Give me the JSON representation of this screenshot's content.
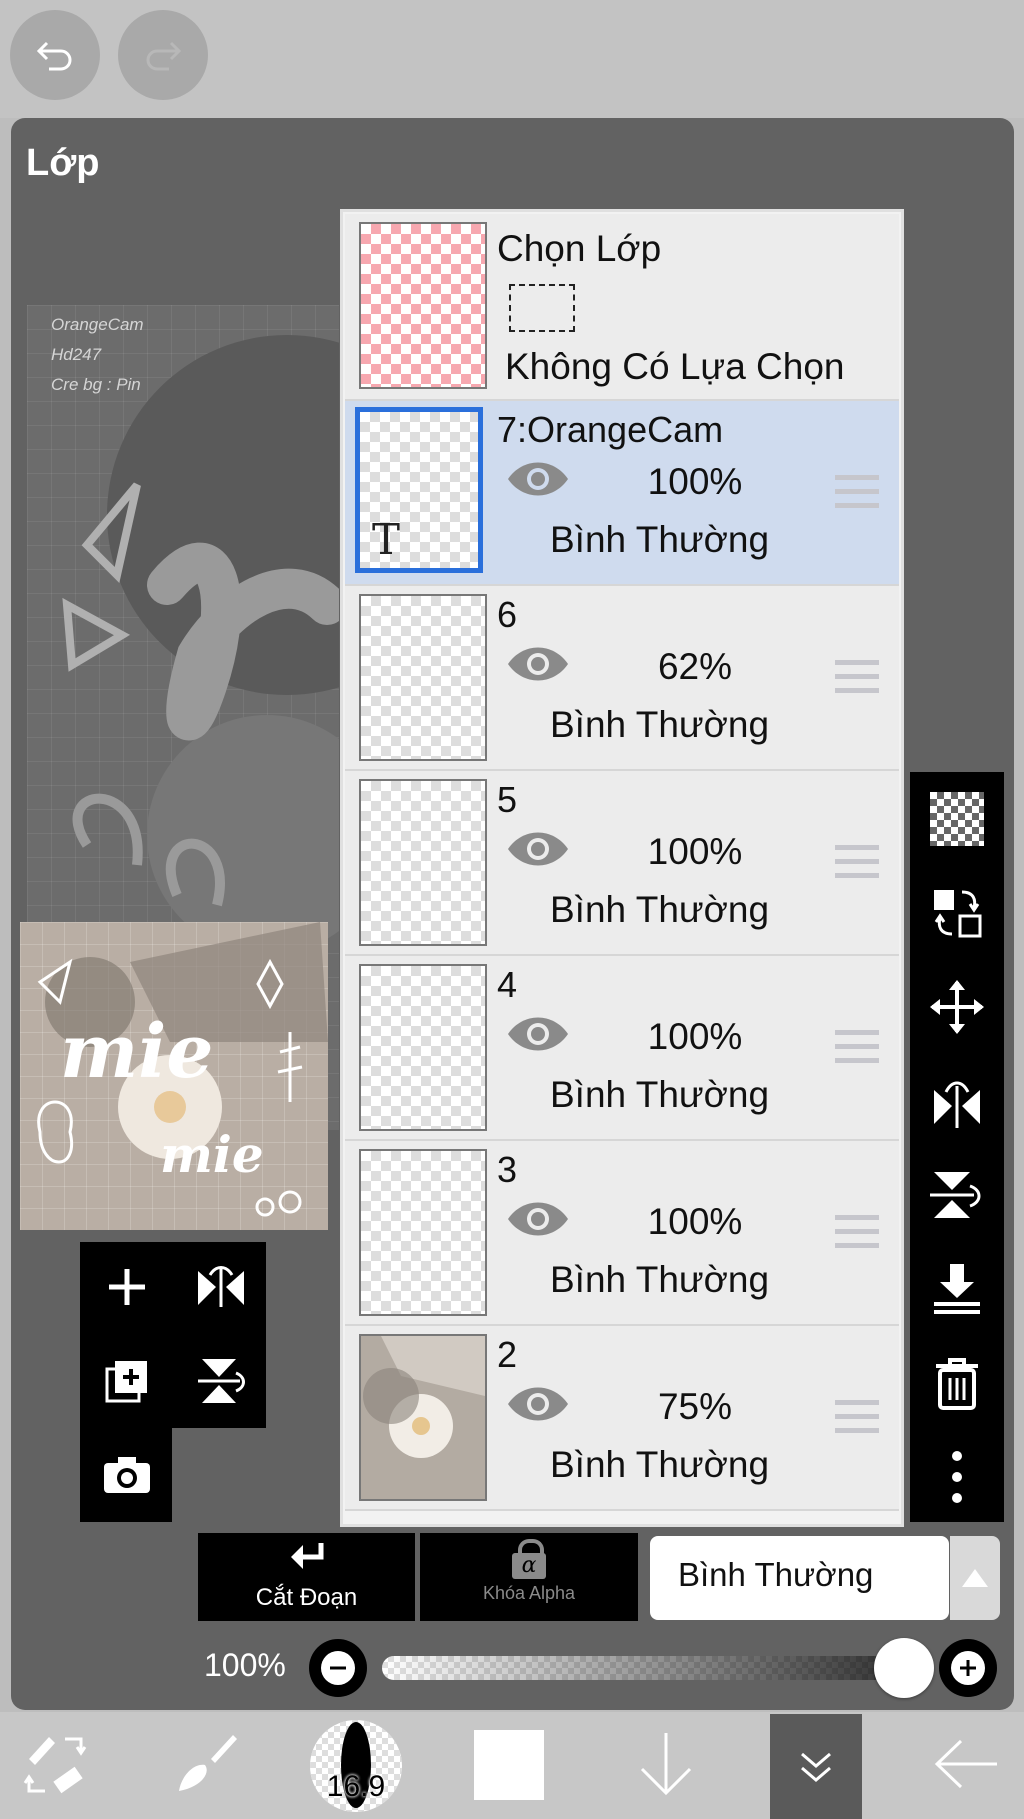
{
  "panel": {
    "title": "Lớp"
  },
  "canvas_watermark": {
    "line1": "OrangeCam",
    "line2": "Hd247",
    "line3": "Cre bg : Pin"
  },
  "selection": {
    "title": "Chọn Lớp",
    "status": "Không Có Lựa Chọn"
  },
  "layers": [
    {
      "name": "7:OrangeCam",
      "opacity": "100%",
      "blend": "Bình Thường",
      "selected": true,
      "type": "text",
      "thumb_text": "T"
    },
    {
      "name": "6",
      "opacity": "62%",
      "blend": "Bình Thường"
    },
    {
      "name": "5",
      "opacity": "100%",
      "blend": "Bình Thường"
    },
    {
      "name": "4",
      "opacity": "100%",
      "blend": "Bình Thường"
    },
    {
      "name": "3",
      "opacity": "100%",
      "blend": "Bình Thường"
    },
    {
      "name": "2",
      "opacity": "75%",
      "blend": "Bình Thường"
    }
  ],
  "controls": {
    "clip_label": "Cắt Đoạn",
    "alpha_lock_label": "Khóa Alpha",
    "alpha_symbol": "α",
    "blend_mode": "Bình Thường",
    "opacity_label": "100%",
    "opacity_value": 1.0
  },
  "bottom_bar": {
    "brush_size": "16.9"
  },
  "colors": {
    "selected_row": "#cfdbee",
    "selected_border": "#2a6fdb",
    "panel_bg": "#626262"
  }
}
